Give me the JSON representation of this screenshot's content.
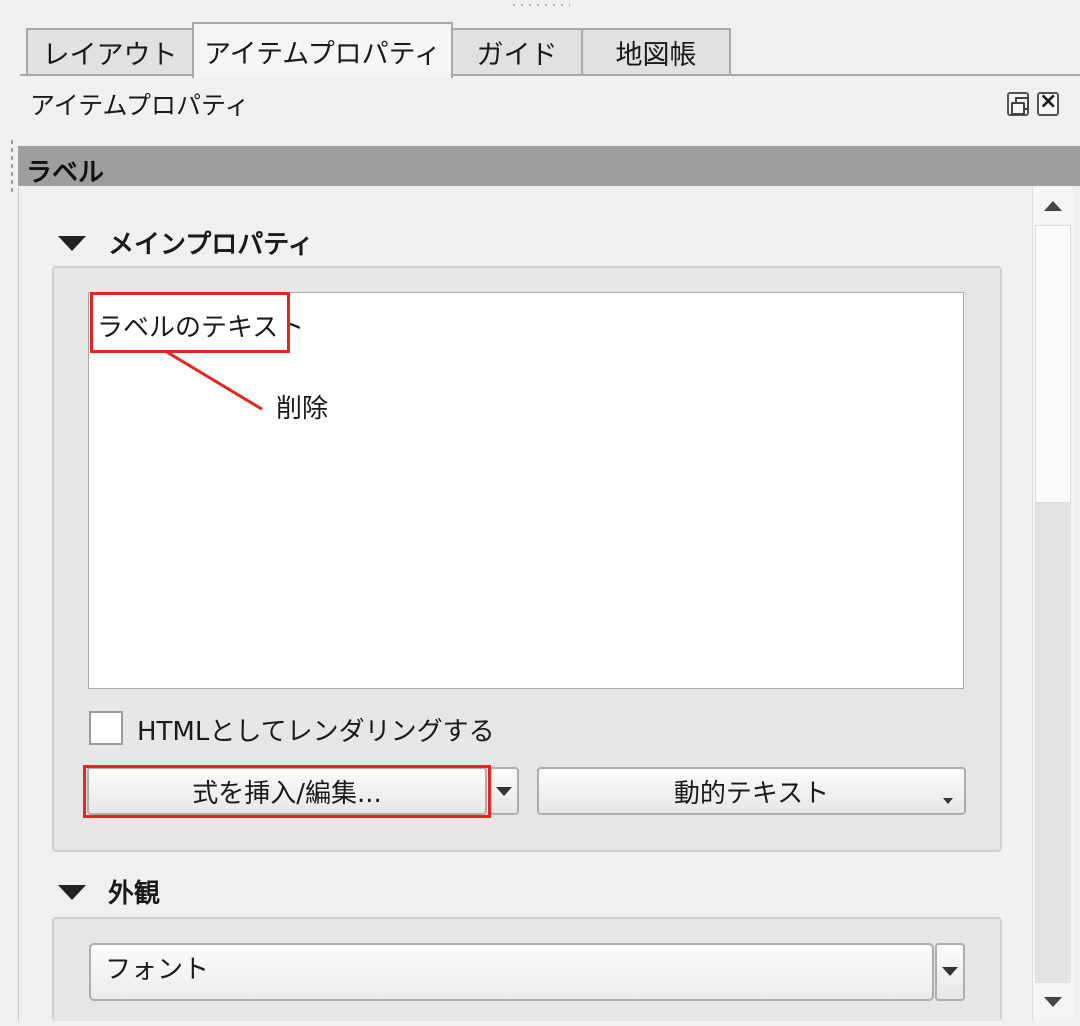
{
  "tabs": [
    {
      "label": "レイアウト",
      "active": false
    },
    {
      "label": "アイテムプロパティ",
      "active": true
    },
    {
      "label": "ガイド",
      "active": false
    },
    {
      "label": "地図帳",
      "active": false
    }
  ],
  "panel": {
    "title": "アイテムプロパティ",
    "float_icon": "float-icon",
    "close_icon": "close-icon"
  },
  "section": {
    "title": "ラベル"
  },
  "main_properties": {
    "title": "メインプロパティ",
    "label_text": "ラベルのテキスト",
    "annotation": "削除",
    "checkbox_label": "HTMLとしてレンダリングする",
    "checkbox_checked": false,
    "insert_button": "式を挿入/編集...",
    "dynamic_text_button": "動的テキスト"
  },
  "appearance": {
    "title": "外観",
    "font_button": "フォント"
  },
  "colors": {
    "annotation": "#e3261f",
    "header": "#9e9e9e"
  }
}
